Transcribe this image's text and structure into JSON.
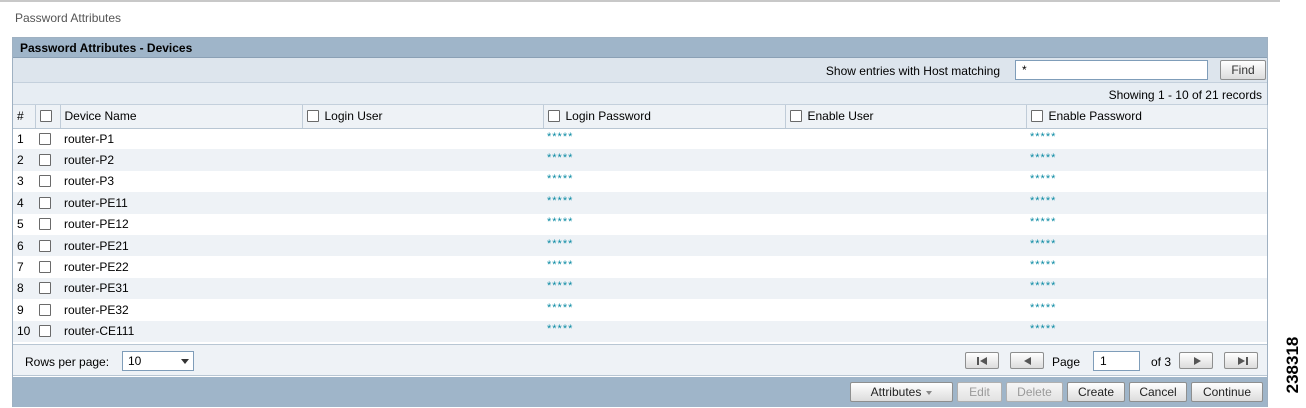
{
  "page": {
    "title": "Password Attributes"
  },
  "panel": {
    "title": "Password Attributes - Devices"
  },
  "filter": {
    "label": "Show entries with Host matching",
    "value": "*",
    "find_label": "Find"
  },
  "records": {
    "text": "Showing 1 - 10 of 21 records"
  },
  "table": {
    "columns": {
      "index": "#",
      "device_name": "Device Name",
      "login_user": "Login User",
      "login_password": "Login Password",
      "enable_user": "Enable User",
      "enable_password": "Enable Password"
    },
    "rows": [
      {
        "num": "1",
        "device": "router-P1",
        "login_user": "",
        "login_password": "*****",
        "enable_user": "",
        "enable_password": "*****"
      },
      {
        "num": "2",
        "device": "router-P2",
        "login_user": "",
        "login_password": "*****",
        "enable_user": "",
        "enable_password": "*****"
      },
      {
        "num": "3",
        "device": "router-P3",
        "login_user": "",
        "login_password": "*****",
        "enable_user": "",
        "enable_password": "*****"
      },
      {
        "num": "4",
        "device": "router-PE11",
        "login_user": "",
        "login_password": "*****",
        "enable_user": "",
        "enable_password": "*****"
      },
      {
        "num": "5",
        "device": "router-PE12",
        "login_user": "",
        "login_password": "*****",
        "enable_user": "",
        "enable_password": "*****"
      },
      {
        "num": "6",
        "device": "router-PE21",
        "login_user": "",
        "login_password": "*****",
        "enable_user": "",
        "enable_password": "*****"
      },
      {
        "num": "7",
        "device": "router-PE22",
        "login_user": "",
        "login_password": "*****",
        "enable_user": "",
        "enable_password": "*****"
      },
      {
        "num": "8",
        "device": "router-PE31",
        "login_user": "",
        "login_password": "*****",
        "enable_user": "",
        "enable_password": "*****"
      },
      {
        "num": "9",
        "device": "router-PE32",
        "login_user": "",
        "login_password": "*****",
        "enable_user": "",
        "enable_password": "*****"
      },
      {
        "num": "10",
        "device": "router-CE111",
        "login_user": "",
        "login_password": "*****",
        "enable_user": "",
        "enable_password": "*****"
      }
    ]
  },
  "pager": {
    "rows_per_page_label": "Rows per page:",
    "rows_per_page_value": "10",
    "page_label": "Page",
    "current_page": "1",
    "of_label": "of 3"
  },
  "actions": {
    "attributes": "Attributes",
    "edit": "Edit",
    "delete": "Delete",
    "create": "Create",
    "cancel": "Cancel",
    "continue": "Continue"
  },
  "figure_id": "238318",
  "colors": {
    "header_blue": "#9fb5c9",
    "mask_teal": "#0a8aa3",
    "row_alt": "#eef2f6"
  }
}
